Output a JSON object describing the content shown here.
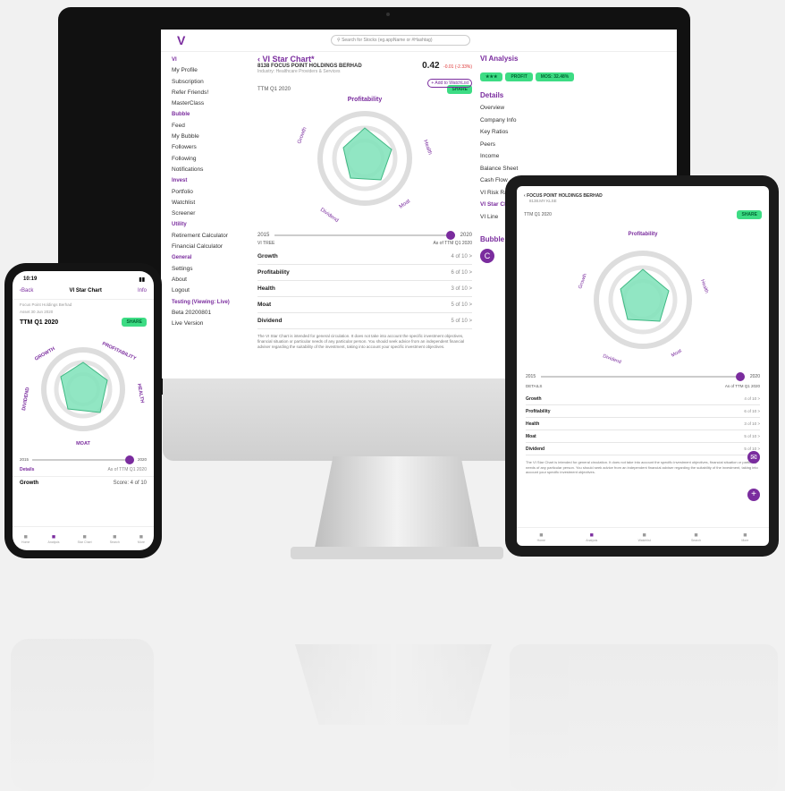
{
  "imac": {
    "logo": "V",
    "search_placeholder": "Search for Stocks (eg.appName or #Hashtag)",
    "sidebar": [
      {
        "type": "hd",
        "label": "VI"
      },
      {
        "type": "it",
        "label": "My Profile"
      },
      {
        "type": "it",
        "label": "Subscription"
      },
      {
        "type": "it",
        "label": "Refer Friends!"
      },
      {
        "type": "it",
        "label": "MasterClass"
      },
      {
        "type": "hd",
        "label": "Bubble"
      },
      {
        "type": "it",
        "label": "Feed"
      },
      {
        "type": "it",
        "label": "My Bubble"
      },
      {
        "type": "it",
        "label": "Followers"
      },
      {
        "type": "it",
        "label": "Following"
      },
      {
        "type": "it",
        "label": "Notifications"
      },
      {
        "type": "hd",
        "label": "Invest"
      },
      {
        "type": "it",
        "label": "Portfolio"
      },
      {
        "type": "it",
        "label": "Watchlist"
      },
      {
        "type": "it",
        "label": "Screener"
      },
      {
        "type": "hd",
        "label": "Utility"
      },
      {
        "type": "it",
        "label": "Retirement Calculator"
      },
      {
        "type": "it",
        "label": "Financial Calculator"
      },
      {
        "type": "hd",
        "label": "General"
      },
      {
        "type": "it",
        "label": "Settings"
      },
      {
        "type": "it",
        "label": "About"
      },
      {
        "type": "it",
        "label": "Logout"
      },
      {
        "type": "hd",
        "label": "Testing (Viewing: Live)"
      },
      {
        "type": "it",
        "label": "Beta 20200801"
      },
      {
        "type": "it",
        "label": "Live Version"
      }
    ],
    "title": "VI Star Chart",
    "company": "8138 FOCUS POINT HOLDINGS BERHAD",
    "industry": "Industry: Healthcare Providers & Services",
    "price": "0.42",
    "price_change": "-0.01 (-2.33%)",
    "add_watchlist": "+ Add to WatchList",
    "period": "TTM Q1 2020",
    "share": "SHARE",
    "radar_labels": {
      "top": "Profitability",
      "left": "Growth",
      "right": "Health",
      "bottom_left": "Dividend",
      "bottom_right": "Moat"
    },
    "slider_from": "2015",
    "slider_to": "2020",
    "details_label": "VI TREE",
    "as_of": "As of TTM Q1 2020",
    "scores": [
      {
        "label": "Growth",
        "value": "4 of 10 >"
      },
      {
        "label": "Profitability",
        "value": "6 of 10 >"
      },
      {
        "label": "Health",
        "value": "3 of 10 >"
      },
      {
        "label": "Moat",
        "value": "5 of 10 >"
      },
      {
        "label": "Dividend",
        "value": "5 of 10 >"
      }
    ],
    "disclaimer": "The VI Star Chart is intended for general circulation. It does not take into account the specific investment objectives, financial situation or particular needs of any particular person. You should seek advice from an independent financial adviser regarding the suitability of the investment, taking into account your specific investment objectives.",
    "analysis_title": "VI Analysis",
    "analysis_pills": [
      "★★★",
      "PROFIT",
      "MOS: 32.48%"
    ],
    "details_title": "Details",
    "details": [
      "Overview",
      "Company Info",
      "Key Ratios",
      "Peers",
      "Income",
      "Balance Sheet",
      "Cash Flow",
      "VI Risk Ratio",
      "VI Star Chart",
      "VI Line"
    ],
    "bubble_title": "Bubble"
  },
  "ipad": {
    "company": "FOCUS POINT HOLDINGS BERHAD",
    "sub": "8138.MY KLSE",
    "period": "TTM Q1 2020",
    "share": "SHARE",
    "radar_labels": {
      "top": "Profitability",
      "left": "Growth",
      "right": "Health",
      "bottom_left": "Dividend",
      "bottom_right": "Moat"
    },
    "slider_from": "2015",
    "slider_to": "2020",
    "details_label": "DETAILS",
    "as_of": "As of TTM Q1 2020",
    "scores": [
      {
        "label": "Growth",
        "value": "4 of 10 >"
      },
      {
        "label": "Profitability",
        "value": "6 of 10 >"
      },
      {
        "label": "Health",
        "value": "3 of 10 >"
      },
      {
        "label": "Moat",
        "value": "5 of 10 >"
      },
      {
        "label": "Dividend",
        "value": "5 of 10 >"
      }
    ],
    "tabs": [
      "Home",
      "Analysis",
      "Watchlist",
      "Search",
      "More"
    ]
  },
  "iphone": {
    "time": "10:19",
    "back": "Back",
    "title": "VI Star Chart",
    "info": "Info",
    "company": "Focus Point Holdings Berhad",
    "date": "Asset 30 Jun 2020",
    "period": "TTM Q1 2020",
    "share": "SHARE",
    "radar_labels": {
      "top": "PROFITABILITY",
      "left": "GROWTH",
      "right": "HEALTH",
      "bottom_left": "DIVIDEND",
      "bottom": "MOAT"
    },
    "slider_from": "2015",
    "slider_to": "2020",
    "details": "Details",
    "as_of": "As of TTM Q1 2020",
    "growth": "Growth",
    "growth_score": "Score: 4 of 10",
    "tabs": [
      "Home",
      "Analysis",
      "Star Chart",
      "Search",
      "More"
    ]
  },
  "colors": {
    "purple": "#7a2c9e",
    "green": "#3ddc84",
    "radar_fill": "#7ee2b8"
  }
}
